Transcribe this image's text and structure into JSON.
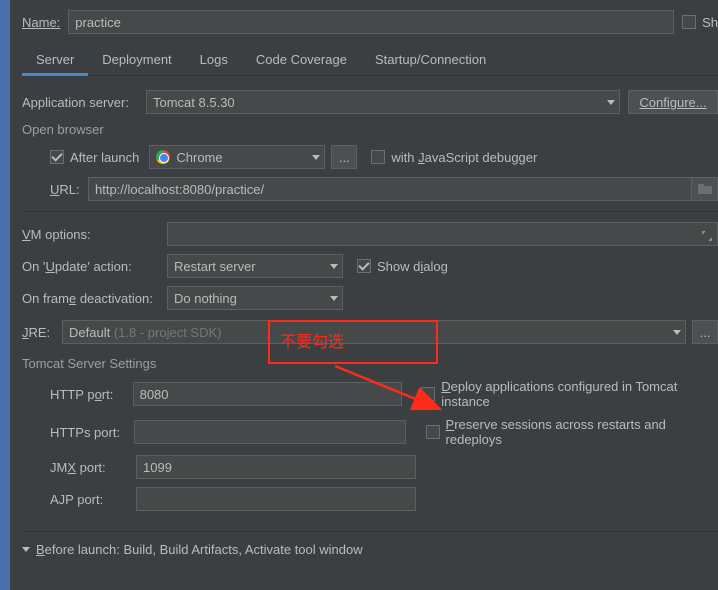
{
  "name": {
    "label": "Name:",
    "value": "practice"
  },
  "share": {
    "label": "Sh"
  },
  "tabs": {
    "server": "Server",
    "deployment": "Deployment",
    "logs": "Logs",
    "coverage": "Code Coverage",
    "startup": "Startup/Connection"
  },
  "app_server": {
    "label": "Application server:",
    "value": "Tomcat 8.5.30",
    "configure": "Configure..."
  },
  "open_browser": {
    "title": "Open browser",
    "after_launch": "After launch",
    "browser": "Chrome",
    "ellipsis": "...",
    "js_debug": "with JavaScript debugger",
    "url_label": "URL:",
    "url_value": "http://localhost:8080/practice/"
  },
  "vm": {
    "label": "VM options:"
  },
  "update": {
    "label": "On 'Update' action:",
    "value": "Restart server",
    "show_dialog": "Show dialog"
  },
  "frame": {
    "label": "On frame deactivation:",
    "value": "Do nothing"
  },
  "jre": {
    "label": "JRE:",
    "value_prefix": "Default",
    "value_suffix": "(1.8 - project SDK)",
    "ellipsis": "..."
  },
  "tomcat": {
    "title": "Tomcat Server Settings",
    "http": {
      "label": "HTTP port:",
      "value": "8080"
    },
    "https": {
      "label": "HTTPs port:",
      "value": ""
    },
    "jmx": {
      "label": "JMX port:",
      "value": "1099"
    },
    "ajp": {
      "label": "AJP port:",
      "value": ""
    },
    "deploy": "Deploy applications configured in Tomcat instance",
    "preserve": "Preserve sessions across restarts and redeploys"
  },
  "before": {
    "label": "Before launch: Build, Build Artifacts, Activate tool window"
  },
  "annotation": "不要勾选"
}
